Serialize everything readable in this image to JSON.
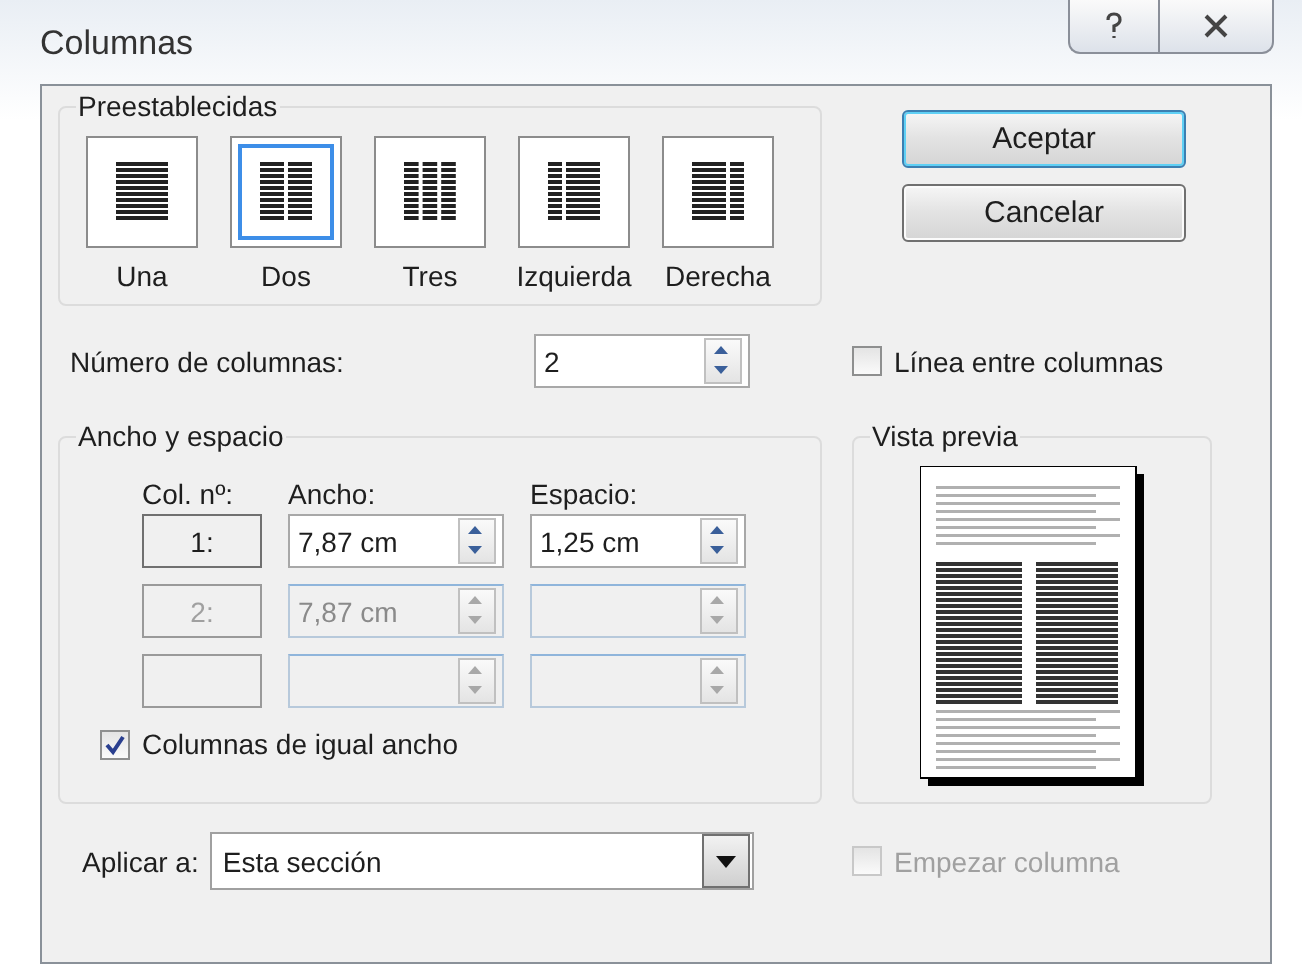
{
  "window": {
    "title": "Columnas"
  },
  "presets": {
    "title": "Preestablecidas",
    "items": [
      {
        "label": "Una",
        "kind": "one",
        "selected": false
      },
      {
        "label": "Dos",
        "kind": "two",
        "selected": true
      },
      {
        "label": "Tres",
        "kind": "three",
        "selected": false
      },
      {
        "label": "Izquierda",
        "kind": "left",
        "selected": false
      },
      {
        "label": "Derecha",
        "kind": "right",
        "selected": false
      }
    ]
  },
  "buttons": [
    {
      "label": "Aceptar",
      "default": true
    },
    {
      "label": "Cancelar",
      "default": false
    }
  ],
  "columns_count": {
    "label": "Número de columnas:",
    "value": "2"
  },
  "line_between": {
    "label": "Línea entre columnas",
    "checked": false
  },
  "width_spacing": {
    "title": "Ancho y espacio",
    "headers": [
      "Col. nº:",
      "Ancho:",
      "Espacio:"
    ],
    "rows": [
      {
        "number": "1:",
        "width": "7,87 cm",
        "spacing": "1,25 cm",
        "disabled": false
      },
      {
        "number": "2:",
        "width": "7,87 cm",
        "disabled": true
      },
      {
        "disabled": true
      }
    ]
  },
  "equal_width": {
    "label": "Columnas de igual ancho",
    "checked": true
  },
  "preview": {
    "title": "Vista previa"
  },
  "apply_to": {
    "label": "Aplicar a:",
    "value": "Esta sección"
  },
  "start_column": {
    "label": "Empezar columna",
    "checked": false,
    "disabled": true
  }
}
